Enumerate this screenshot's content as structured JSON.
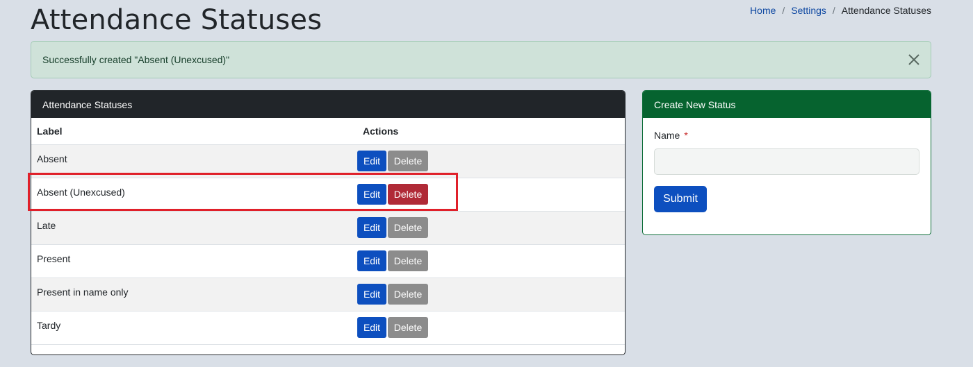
{
  "page": {
    "title": "Attendance Statuses"
  },
  "breadcrumb": {
    "home": "Home",
    "settings": "Settings",
    "current": "Attendance Statuses",
    "separator": "/"
  },
  "alert": {
    "message": "Successfully created \"Absent (Unexcused)\"",
    "close_icon": "close-icon"
  },
  "statuses_card": {
    "title": "Attendance Statuses",
    "columns": {
      "label": "Label",
      "actions": "Actions"
    },
    "rows": [
      {
        "label": "Absent",
        "edit": "Edit",
        "delete": "Delete"
      },
      {
        "label": "Absent (Unexcused)",
        "edit": "Edit",
        "delete": "Delete"
      },
      {
        "label": "Late",
        "edit": "Edit",
        "delete": "Delete"
      },
      {
        "label": "Present",
        "edit": "Edit",
        "delete": "Delete"
      },
      {
        "label": "Present in name only",
        "edit": "Edit",
        "delete": "Delete"
      },
      {
        "label": "Tardy",
        "edit": "Edit",
        "delete": "Delete"
      }
    ]
  },
  "create_card": {
    "title": "Create New Status",
    "name_label": "Name",
    "required_marker": "*",
    "name_value": "",
    "submit": "Submit"
  },
  "colors": {
    "background": "#d9dfe7",
    "primary": "#0d4fbf",
    "danger": "#b02a37",
    "secondary": "#8c8c8c",
    "success_header": "#06632f",
    "highlight": "#e0202a"
  }
}
